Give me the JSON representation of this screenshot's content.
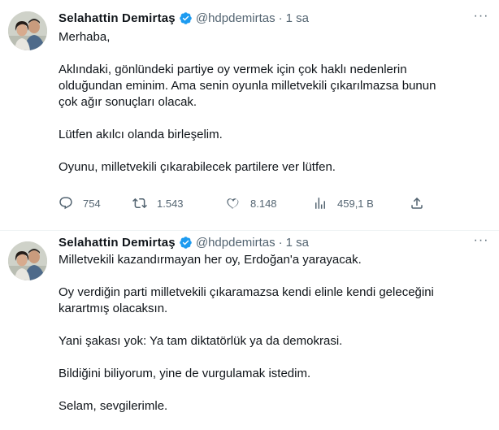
{
  "tweets": [
    {
      "author": {
        "name": "Selahattin Demirtaş",
        "handle": "@hdpdemirtas",
        "verified": true
      },
      "separator": "·",
      "time": "1 sa",
      "more_label": "···",
      "paragraphs": [
        "Merhaba,",
        "Aklındaki, gönlündeki partiye oy vermek için çok haklı nedenlerin\nolduğundan eminim. Ama senin oyunla milletvekili çıkarılmazsa bunun\nçok ağır sonuçları olacak.",
        "Lütfen akılcı olanda birleşelim.",
        "Oyunu, milletvekili çıkarabilecek partilere ver lütfen."
      ],
      "stats": {
        "replies": "754",
        "retweets": "1.543",
        "likes": "8.148",
        "views": "459,1 B"
      }
    },
    {
      "author": {
        "name": "Selahattin Demirtaş",
        "handle": "@hdpdemirtas",
        "verified": true
      },
      "separator": "·",
      "time": "1 sa",
      "more_label": "···",
      "paragraphs": [
        "Milletvekili kazandırmayan her oy, Erdoğan'a yarayacak.",
        "Oy verdiğin parti milletvekili çıkaramazsa kendi elinle kendi geleceğini\nkarartmış olacaksın.",
        "Yani şakası yok: Ya tam diktatörlük ya da demokrasi.",
        "Bildiğini biliyorum, yine de vurgulamak istedim.",
        "Selam, sevgilerimle."
      ]
    }
  ],
  "colors": {
    "text": "#0f1419",
    "secondary": "#536471",
    "verified": "#1d9bf0",
    "divider": "#eff3f4"
  },
  "icons": [
    "verified-badge-icon",
    "more-icon",
    "reply-icon",
    "retweet-icon",
    "like-icon",
    "views-icon",
    "share-icon"
  ]
}
